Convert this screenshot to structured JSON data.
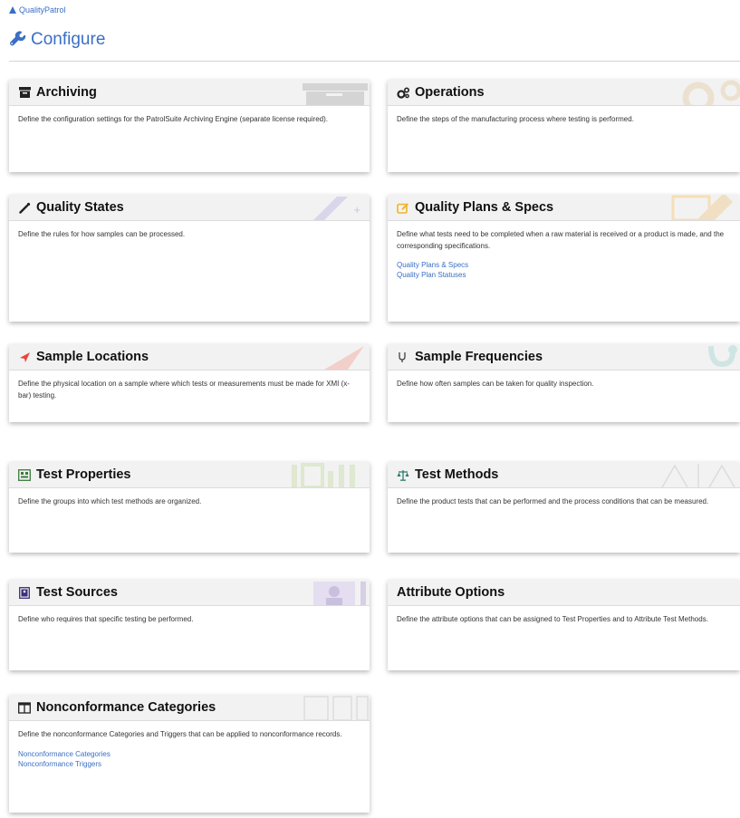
{
  "breadcrumb": {
    "app_name": "QualityPatrol"
  },
  "page": {
    "title": "Configure"
  },
  "colors": {
    "accent": "#3a6fc4",
    "warning": "#f0b429",
    "danger": "#e8453c"
  },
  "cards": {
    "archiving": {
      "title": "Archiving",
      "description": "Define the configuration settings for the PatrolSuite Archiving Engine (separate license required)."
    },
    "operations": {
      "title": "Operations",
      "description": "Define the steps of the manufacturing process where testing is performed."
    },
    "quality_states": {
      "title": "Quality States",
      "description": "Define the rules for how samples can be processed."
    },
    "quality_plans": {
      "title": "Quality Plans & Specs",
      "description": "Define what tests need to be completed when a raw material is received or a product is made, and the corresponding specifications.",
      "links": [
        "Quality Plans & Specs",
        "Quality Plan Statuses"
      ]
    },
    "sample_locations": {
      "title": "Sample Locations",
      "description": "Define the physical location on a sample where which tests or measurements must be made for XMI (x-bar) testing."
    },
    "sample_frequencies": {
      "title": "Sample Frequencies",
      "description": "Define how often samples can be taken for quality inspection."
    },
    "test_properties": {
      "title": "Test Properties",
      "description": "Define the groups into which test methods are organized."
    },
    "test_methods": {
      "title": "Test Methods",
      "description": "Define the product tests that can be performed and the process conditions that can be measured."
    },
    "test_sources": {
      "title": "Test Sources",
      "description": "Define who requires that specific testing be performed."
    },
    "attribute_options": {
      "title": "Attribute Options",
      "description": "Define the attribute options that can be assigned to Test Properties and to Attribute Test Methods."
    },
    "nonconformance": {
      "title": "Nonconformance Categories",
      "description": "Define the nonconformance Categories and Triggers that can be applied to nonconformance records.",
      "links": [
        "Nonconformance Categories",
        "Nonconformance Triggers"
      ]
    }
  }
}
